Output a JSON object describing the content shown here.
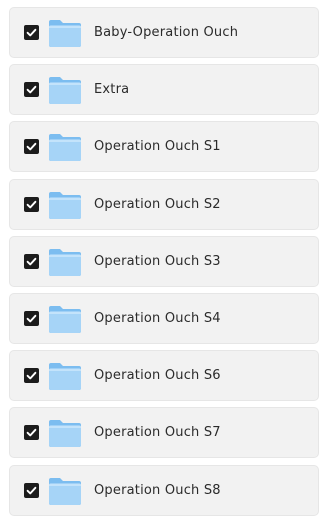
{
  "folders": [
    {
      "name": "Baby-Operation Ouch",
      "checked": true
    },
    {
      "name": "Extra",
      "checked": true
    },
    {
      "name": "Operation Ouch S1",
      "checked": true
    },
    {
      "name": "Operation Ouch S2",
      "checked": true
    },
    {
      "name": "Operation Ouch S3",
      "checked": true
    },
    {
      "name": "Operation Ouch S4",
      "checked": true
    },
    {
      "name": "Operation Ouch S6",
      "checked": true
    },
    {
      "name": "Operation Ouch S7",
      "checked": true
    },
    {
      "name": "Operation Ouch S8",
      "checked": true
    }
  ],
  "icons": {
    "checkbox": "check-icon",
    "folder": "folder-icon"
  },
  "colors": {
    "row_bg": "#f2f2f2",
    "checkbox": "#1c1c1c",
    "folder_front": "#9fd0f5",
    "folder_back": "#7cbdf0"
  }
}
